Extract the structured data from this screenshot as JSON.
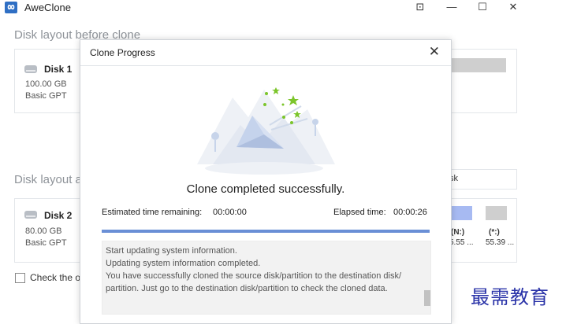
{
  "app": {
    "title": "AweClone",
    "controls": {
      "restore": "⊡",
      "minimize": "—",
      "maximize": "☐",
      "close": "✕"
    }
  },
  "main": {
    "before_title": "Disk layout before clone",
    "after_title": "Disk layout a",
    "disk1": {
      "name": "Disk 1",
      "size": "100.00 GB",
      "type": "Basic GPT"
    },
    "disk2": {
      "name": "Disk 2",
      "size": "80.00 GB",
      "type": "Basic GPT"
    },
    "after_field_fragment": "sk",
    "partitions": [
      {
        "label": "(N:)",
        "size": "5.55 ...",
        "color": "#a7baf2"
      },
      {
        "label": "(*:)",
        "size": "55.39 ...",
        "color": "#cfcfcf"
      }
    ],
    "checkbox_label": "Check the o"
  },
  "dialog": {
    "title": "Clone Progress",
    "close": "✕",
    "status": "Clone completed successfully.",
    "estimated_label": "Estimated time remaining:",
    "estimated_value": "00:00:00",
    "elapsed_label": "Elapsed time:",
    "elapsed_value": "00:00:26",
    "progress_percent": 100,
    "log": [
      "Start updating system information.",
      "Updating system information completed.",
      "You have successfully cloned the source disk/partition to the destination disk/",
      "partition. Just go to the destination disk/partition to check the cloned data."
    ]
  },
  "watermark": "最需教育",
  "colors": {
    "accent": "#6a8fd6",
    "star_green": "#7cc52b",
    "brand": "#2f6fc4"
  },
  "icons": {
    "app_logo": "infinity-icon",
    "disk": "hard-disk-icon",
    "illustration": "envelope-celebration-icon"
  }
}
